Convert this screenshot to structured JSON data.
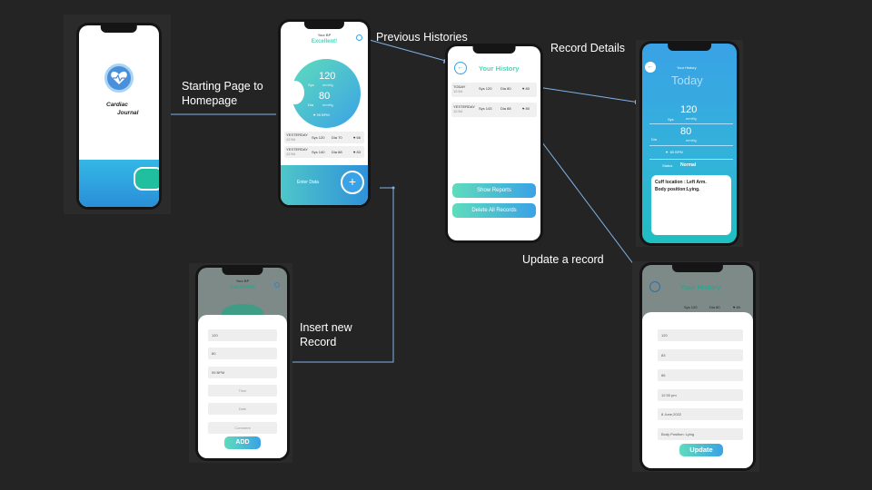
{
  "labels": {
    "starting_page": "Starting Page to\nHomepage",
    "previous_histories": "Previous Histories",
    "record_details": "Record Details",
    "insert_record": "Insert new\nRecord",
    "update_record": "Update a record"
  },
  "splash": {
    "app_name_line1": "Cardiac",
    "app_name_line2": "Journal"
  },
  "home": {
    "your_bp": "Your BP",
    "status": "Excellent!",
    "sys_value": "120",
    "sys_label": "Sys",
    "sys_unit": "mmHg",
    "dia_value": "80",
    "dia_label": "Dia",
    "dia_unit": "mmHg",
    "bpm": "99 BPM",
    "records": [
      {
        "day": "YESTERDAY",
        "time": "12:54",
        "sys": "Sys 120",
        "dia": "Dia 70",
        "bpm": "66"
      },
      {
        "day": "YESTERDAY",
        "time": "12:54",
        "sys": "Sys 140",
        "dia": "Dia 88",
        "bpm": "83"
      }
    ],
    "enter_data": "Enter Data",
    "add_symbol": "+"
  },
  "history": {
    "title": "Your History",
    "records": [
      {
        "day": "TODAY",
        "time": "12:54",
        "sys": "Sys 120",
        "dia": "Dia 80",
        "bpm": "80"
      },
      {
        "day": "YESTERDAY",
        "time": "12:54",
        "sys": "Sys 143",
        "dia": "Dia 88",
        "bpm": "80"
      }
    ],
    "show_reports": "Show Reports",
    "delete_all": "Delete All Records"
  },
  "details": {
    "header": "Your History",
    "today": "Today",
    "sys_label": "Sys",
    "sys_value": "120",
    "sys_unit": "mmHg",
    "dia_label": "Dia",
    "dia_value": "80",
    "dia_unit": "mmHg",
    "bpm": "80 BPM",
    "status_label": "Status",
    "status_value": "Normal",
    "note": "Cuff location : Left Arm.\nBody position:Lying."
  },
  "insert": {
    "your_bp": "Your BP",
    "status": "Excellent!",
    "fields": [
      "120",
      "80",
      "99 BPM",
      "Time",
      "Date",
      "Comment"
    ],
    "add_button": "ADD"
  },
  "update": {
    "title": "Your History",
    "record": {
      "sys": "Sys 120",
      "dia": "Dia 80",
      "bpm": "80"
    },
    "fields": [
      "120",
      "83",
      "86",
      "12:30 pm",
      "8 June,2022",
      "Body Position: Lying"
    ],
    "update_button": "Update"
  },
  "colors": {
    "background": "#242424",
    "teal": "#4fd3b8",
    "blue": "#3aa2e6",
    "connector": "#7fb2e8"
  }
}
